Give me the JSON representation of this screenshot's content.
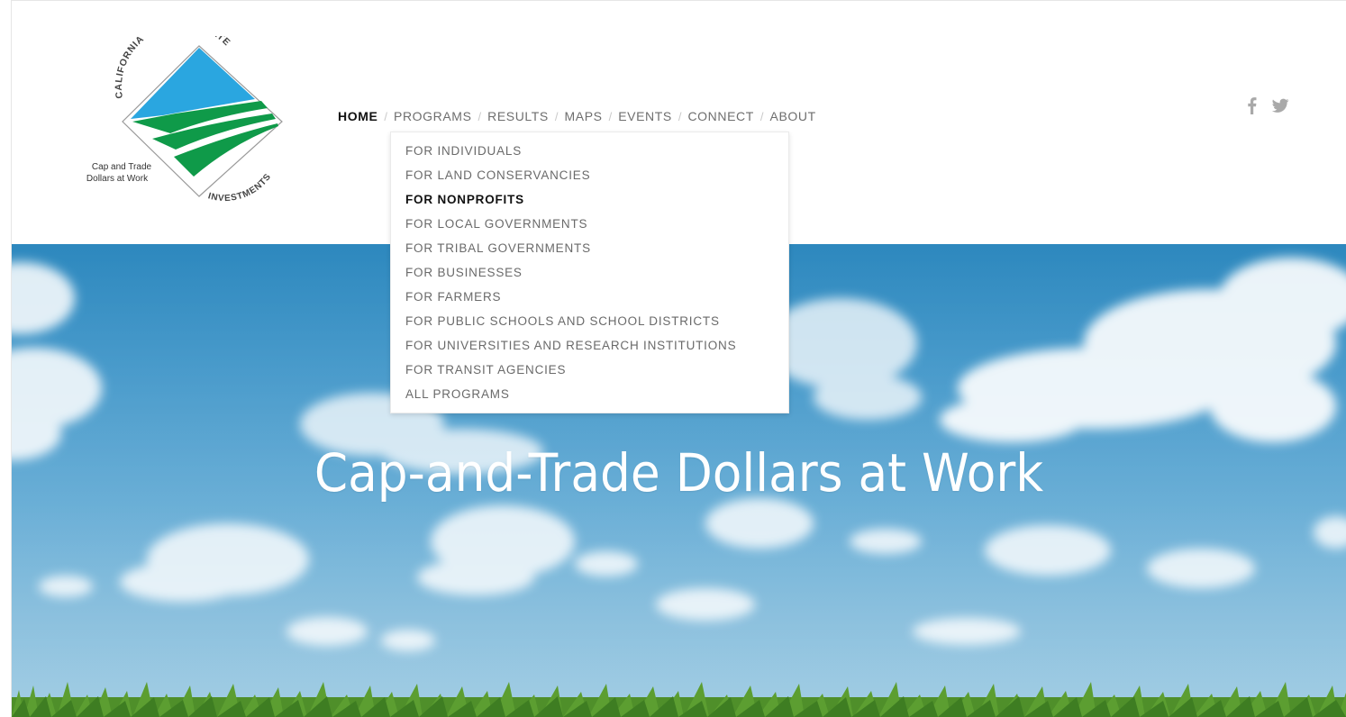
{
  "logo": {
    "arc_top_left": "CALIFORNIA",
    "arc_top_right": "CLIMATE",
    "arc_bottom": "INVESTMENTS",
    "tagline_line1": "Cap and Trade",
    "tagline_line2": "Dollars at Work"
  },
  "nav": {
    "items": [
      {
        "label": "HOME",
        "active": true
      },
      {
        "label": "PROGRAMS"
      },
      {
        "label": "RESULTS"
      },
      {
        "label": "MAPS"
      },
      {
        "label": "EVENTS"
      },
      {
        "label": "CONNECT"
      },
      {
        "label": "ABOUT"
      }
    ],
    "separator": "/"
  },
  "programs_menu": {
    "items": [
      {
        "label": "FOR INDIVIDUALS"
      },
      {
        "label": "FOR LAND CONSERVANCIES"
      },
      {
        "label": "FOR NONPROFITS",
        "active": true
      },
      {
        "label": "FOR LOCAL GOVERNMENTS"
      },
      {
        "label": "FOR TRIBAL GOVERNMENTS"
      },
      {
        "label": "FOR BUSINESSES"
      },
      {
        "label": "FOR FARMERS"
      },
      {
        "label": "FOR PUBLIC SCHOOLS AND SCHOOL DISTRICTS"
      },
      {
        "label": "FOR UNIVERSITIES AND RESEARCH INSTITUTIONS"
      },
      {
        "label": "FOR TRANSIT AGENCIES"
      },
      {
        "label": "ALL PROGRAMS"
      }
    ]
  },
  "social": {
    "icons": [
      "facebook-icon",
      "twitter-icon"
    ],
    "color": "#a9a9a9"
  },
  "hero": {
    "title": "Cap-and-Trade Dollars at Work"
  },
  "colors": {
    "logo_blue": "#2aa6e0",
    "logo_green": "#0f9a49",
    "sky": "#3f95c8",
    "grass": "#4f8f2a"
  }
}
